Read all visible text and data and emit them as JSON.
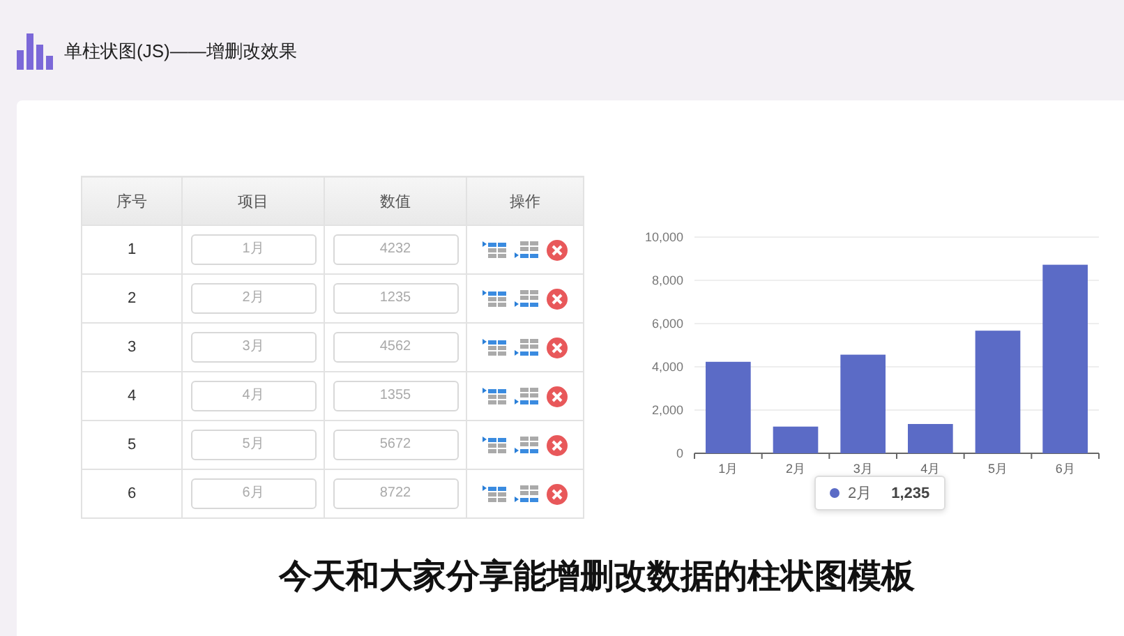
{
  "header": {
    "title": "单柱状图(JS)——增删改效果"
  },
  "table": {
    "columns": [
      "序号",
      "项目",
      "数值",
      "操作"
    ],
    "rows": [
      {
        "index": "1",
        "item": {
          "placeholder": "1月"
        },
        "value": {
          "placeholder": "4232"
        }
      },
      {
        "index": "2",
        "item": {
          "placeholder": "2月"
        },
        "value": {
          "placeholder": "1235"
        }
      },
      {
        "index": "3",
        "item": {
          "placeholder": "3月"
        },
        "value": {
          "placeholder": "4562"
        }
      },
      {
        "index": "4",
        "item": {
          "placeholder": "4月"
        },
        "value": {
          "placeholder": "1355"
        }
      },
      {
        "index": "5",
        "item": {
          "placeholder": "5月"
        },
        "value": {
          "placeholder": "5672"
        }
      },
      {
        "index": "6",
        "item": {
          "placeholder": "6月"
        },
        "value": {
          "placeholder": "8722"
        }
      }
    ]
  },
  "chart": {
    "chart_data": {
      "type": "bar",
      "grid": true,
      "categories": [
        "1月",
        "2月",
        "3月",
        "4月",
        "5月",
        "6月"
      ],
      "series": [
        {
          "color": "#5b6bc6",
          "values": [
            4232,
            1235,
            4562,
            1355,
            5672,
            8722
          ]
        }
      ],
      "ylim": [
        0,
        10000
      ],
      "yticks": [
        {
          "value": 0,
          "label": "0"
        },
        {
          "value": 2000,
          "label": "2,000"
        },
        {
          "value": 4000,
          "label": "4,000"
        },
        {
          "value": 6000,
          "label": "6,000"
        },
        {
          "value": 8000,
          "label": "8,000"
        },
        {
          "value": 10000,
          "label": "10,000"
        }
      ]
    },
    "tooltip": {
      "label": "2月",
      "value": "1,235"
    }
  },
  "caption": "今天和大家分享能增删改数据的柱状图模板"
}
